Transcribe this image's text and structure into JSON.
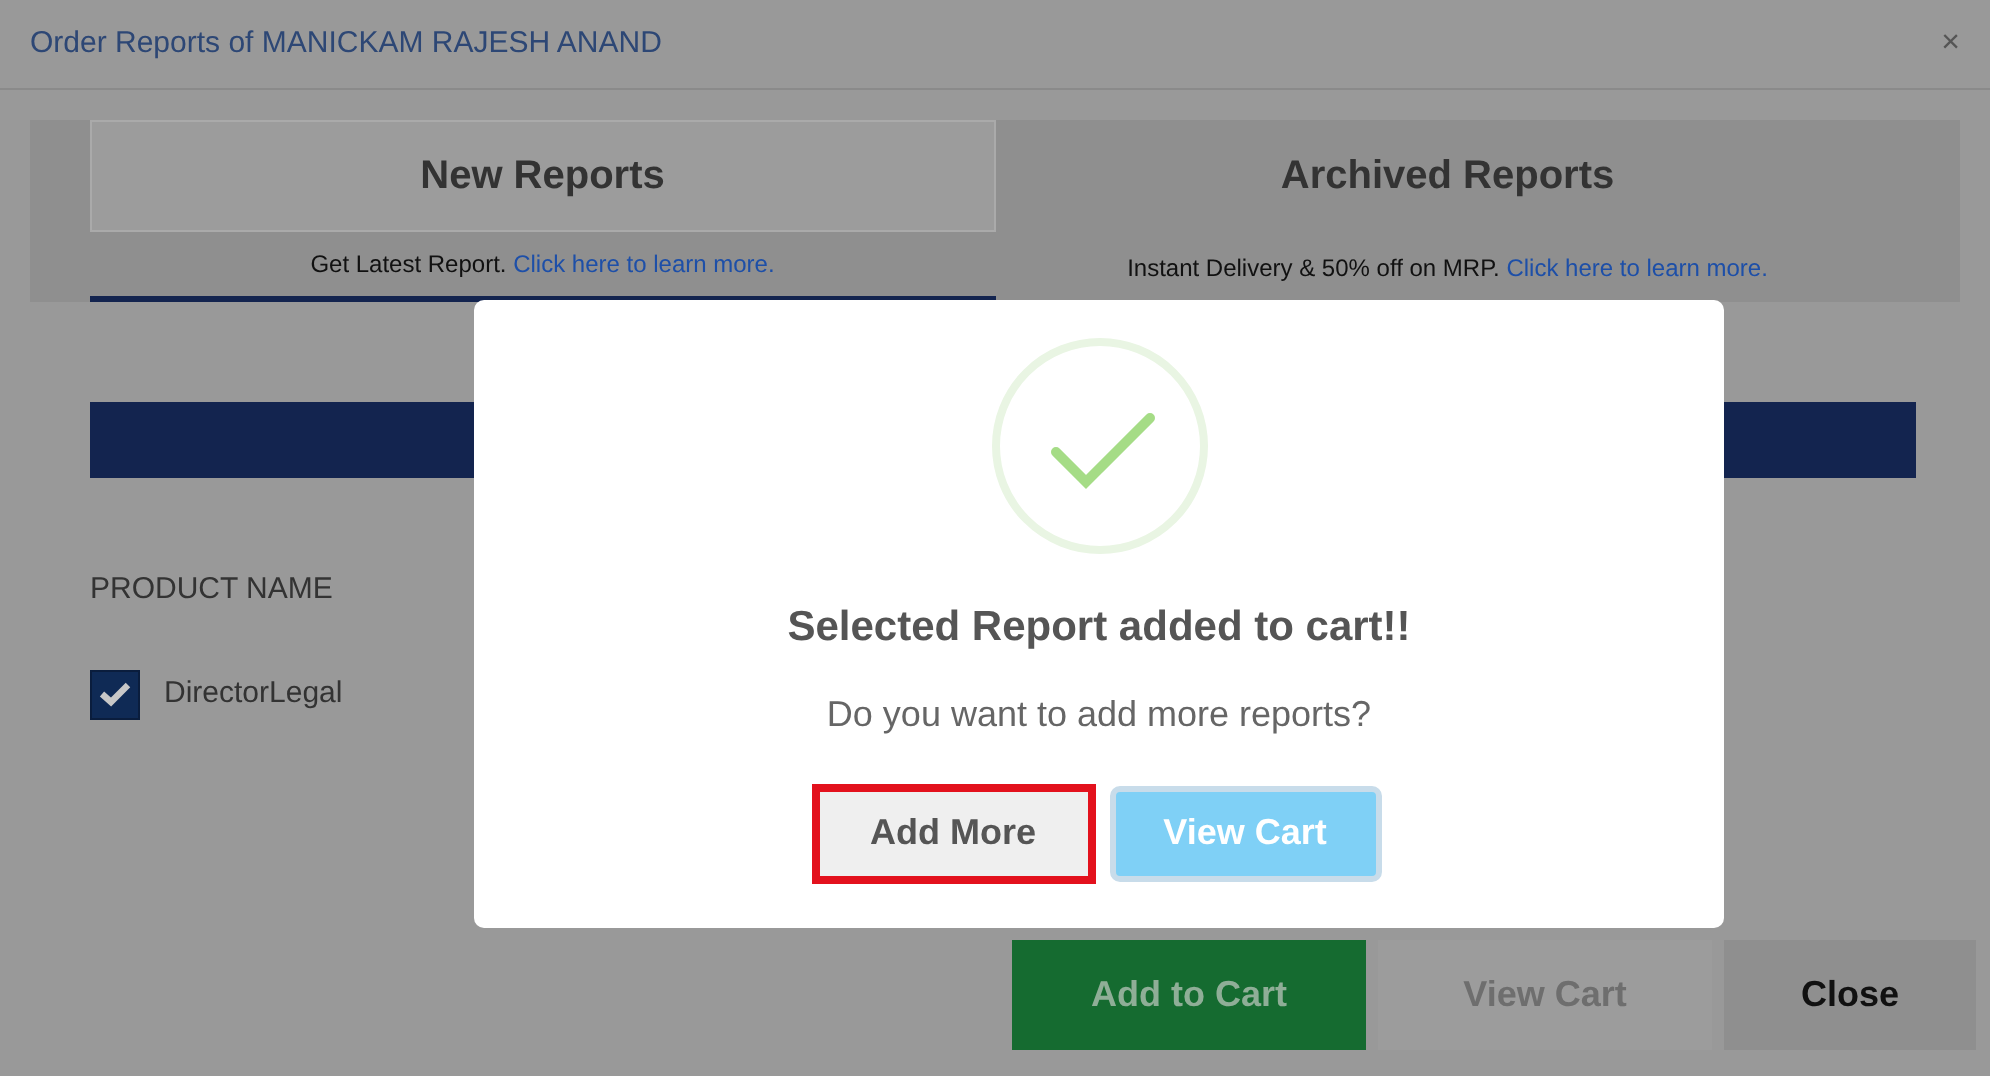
{
  "dialog": {
    "title": "Order Reports of MANICKAM RAJESH ANAND",
    "close": "×"
  },
  "tabs": [
    {
      "label": "New Reports",
      "text": "Get Latest Report.",
      "link": "Click here to learn more.",
      "selected": true
    },
    {
      "label": "Archived Reports",
      "text": "Instant Delivery & 50% off on MRP.",
      "link": "Click here to learn more.",
      "selected": false
    }
  ],
  "table": {
    "column": "PRODUCT NAME",
    "rows": [
      {
        "name": "DirectorLegal",
        "checked": true
      }
    ]
  },
  "footer_buttons": [
    {
      "label": "Add to Cart",
      "kind": "primary"
    },
    {
      "label": "View Cart",
      "kind": "muted"
    },
    {
      "label": "Close",
      "kind": "plain"
    }
  ],
  "modal": {
    "message": "Selected Report added to cart!!",
    "question": "Do you want to add more reports?",
    "buttons": [
      {
        "label": "Add More",
        "kind": "secondary",
        "highlighted": true
      },
      {
        "label": "View Cart",
        "kind": "info",
        "highlighted": false
      }
    ]
  }
}
